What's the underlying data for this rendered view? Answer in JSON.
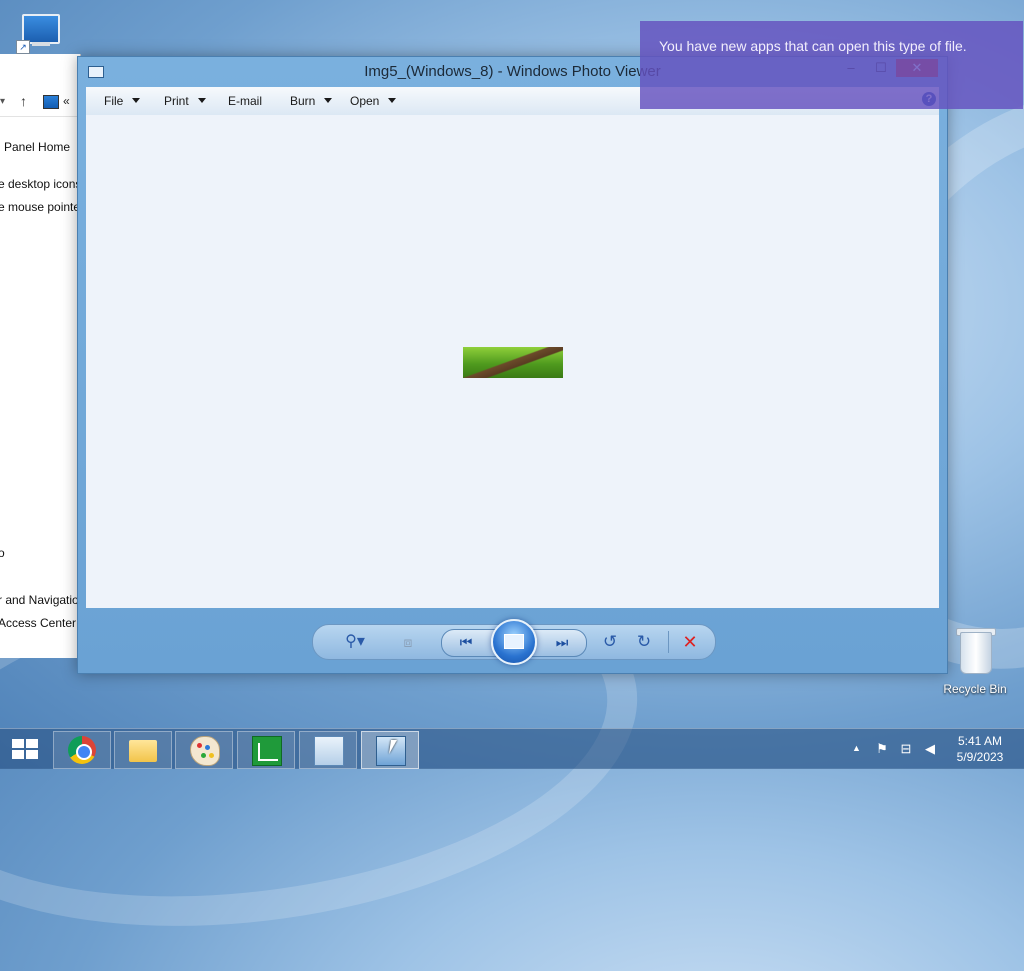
{
  "desktop": {
    "recycle_bin_label": "Recycle Bin"
  },
  "control_panel": {
    "breadcrumb": "«",
    "links": [
      "l Panel Home",
      "e desktop icons",
      "e mouse pointe",
      "o",
      "r and Navigatio",
      "Access Center"
    ]
  },
  "photo_viewer": {
    "title": "Img5_(Windows_8) - Windows Photo Viewer",
    "window_buttons": {
      "minimize": "–",
      "maximize": "☐",
      "close": "✕"
    },
    "menu": [
      {
        "label": "File",
        "has_arrow": true
      },
      {
        "label": "Print",
        "has_arrow": true
      },
      {
        "label": "E-mail",
        "has_arrow": false
      },
      {
        "label": "Burn",
        "has_arrow": true
      },
      {
        "label": "Open",
        "has_arrow": true
      }
    ],
    "help": "?",
    "controls": {
      "zoom": "⚲▾",
      "fit": "⧈",
      "prev": "⏮",
      "next": "⏭",
      "rotate_left": "↺",
      "rotate_right": "↻",
      "delete": "✕"
    }
  },
  "toast": {
    "message": "You have new apps that can open this type of file."
  },
  "taskbar": {
    "apps": [
      "chrome",
      "file-explorer",
      "paint",
      "chart-app",
      "control-panel",
      "photo-viewer"
    ],
    "active_app": "photo-viewer",
    "tray_arrow": "▲",
    "time": "5:41 AM",
    "date": "5/9/2023"
  },
  "colors": {
    "toast_bg": "#6450be",
    "close_button": "#c7403a",
    "viewer_frame": "#7ab0de"
  }
}
